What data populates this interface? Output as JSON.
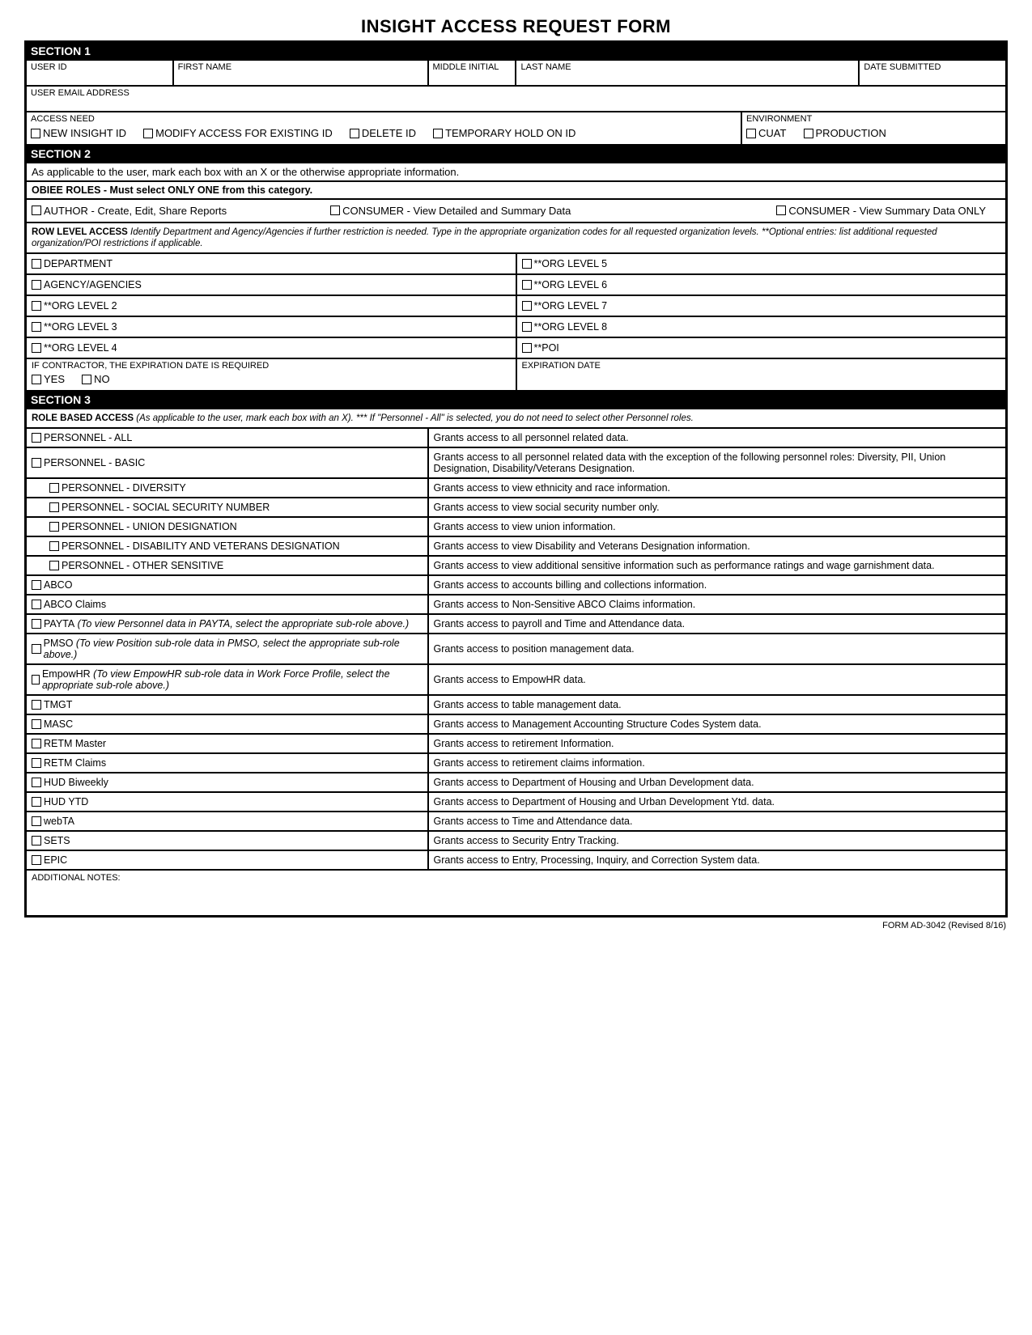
{
  "title": "INSIGHT ACCESS REQUEST FORM",
  "footer": "FORM AD-3042 (Revised 8/16)",
  "s1": {
    "header": "SECTION 1",
    "user_id": "USER ID",
    "first_name": "FIRST NAME",
    "mi": "MIDDLE INITIAL",
    "last_name": "LAST NAME",
    "date_sub": "DATE SUBMITTED",
    "email": "USER EMAIL ADDRESS",
    "access_need": "ACCESS NEED",
    "opt_new": "NEW INSIGHT ID",
    "opt_modify": "MODIFY ACCESS FOR EXISTING ID",
    "opt_delete": "DELETE ID",
    "opt_hold": "TEMPORARY HOLD ON ID",
    "env": "ENVIRONMENT",
    "env_cuat": "CUAT",
    "env_prod": "PRODUCTION"
  },
  "s2": {
    "header": "SECTION 2",
    "instr": "As applicable to the user, mark each box with an X or the otherwise appropriate information.",
    "obiee_hdr": "OBIEE ROLES - Must select ONLY ONE from this category.",
    "obiee_author": "AUTHOR - Create, Edit, Share Reports",
    "obiee_cons1": "CONSUMER - View Detailed and Summary Data",
    "obiee_cons2": "CONSUMER - View Summary Data ONLY",
    "rla_hdr": "ROW LEVEL ACCESS",
    "rla_txt": " Identify Department and Agency/Agencies if further restriction is needed. Type in the appropriate organization codes for all requested organization levels. **Optional entries: list additional requested organization/POI restrictions if applicable.",
    "dept": "DEPARTMENT",
    "agency": "AGENCY/AGENCIES",
    "ol2": "**ORG LEVEL 2",
    "ol3": "**ORG LEVEL 3",
    "ol4": "**ORG LEVEL 4",
    "ol5": "**ORG LEVEL 5",
    "ol6": "**ORG LEVEL 6",
    "ol7": "**ORG LEVEL 7",
    "ol8": "**ORG LEVEL 8",
    "poi": "**POI",
    "contractor": "IF CONTRACTOR, THE EXPIRATION DATE IS REQUIRED",
    "yes": "YES",
    "no": "NO",
    "expdate": "EXPIRATION DATE"
  },
  "s3": {
    "header": "SECTION 3",
    "rba_hdr": "ROLE BASED ACCESS",
    "rba_txt": " (As applicable to the user, mark each box with an X). *** If \"Personnel - All\" is selected, you do not need to select other Personnel roles.",
    "roles": [
      {
        "l": "PERSONNEL - ALL",
        "d": "Grants access to all personnel related data.",
        "indent": false
      },
      {
        "l": "PERSONNEL - BASIC",
        "d": "Grants access to all personnel related data with the exception of the following personnel roles: Diversity, PII, Union Designation, Disability/Veterans Designation.",
        "indent": false
      },
      {
        "l": "PERSONNEL - DIVERSITY",
        "d": "Grants access to view ethnicity and race information.",
        "indent": true
      },
      {
        "l": "PERSONNEL - SOCIAL SECURITY NUMBER",
        "d": "Grants access to view social security number only.",
        "indent": true
      },
      {
        "l": "PERSONNEL - UNION DESIGNATION",
        "d": "Grants access to view union information.",
        "indent": true
      },
      {
        "l": "PERSONNEL - DISABILITY AND VETERANS DESIGNATION",
        "d": "Grants access to view Disability and Veterans Designation information.",
        "indent": true
      },
      {
        "l": "PERSONNEL - OTHER SENSITIVE",
        "d": "Grants access to view additional sensitive information such as performance ratings and wage garnishment data.",
        "indent": true
      },
      {
        "l": "ABCO",
        "d": "Grants access to accounts billing and collections information.",
        "indent": false
      },
      {
        "l": "ABCO Claims",
        "d": "Grants access to Non-Sensitive ABCO Claims information.",
        "indent": false
      },
      {
        "l": "PAYTA",
        "note": " (To view Personnel data in PAYTA, select the appropriate sub-role above.)",
        "d": "Grants access to payroll and Time and Attendance data.",
        "indent": false
      },
      {
        "l": "PMSO",
        "note": " (To view Position sub-role data in PMSO, select the appropriate sub-role above.)",
        "d": "Grants access to position management data.",
        "indent": false
      },
      {
        "l": "EmpowHR",
        "note": " (To view EmpowHR sub-role data in Work Force Profile, select the appropriate sub-role above.)",
        "d": "Grants access to EmpowHR data.",
        "indent": false
      },
      {
        "l": "TMGT",
        "d": "Grants access to table management data.",
        "indent": false
      },
      {
        "l": "MASC",
        "d": "Grants access to Management Accounting Structure Codes System data.",
        "indent": false
      },
      {
        "l": "RETM Master",
        "d": "Grants access to retirement Information.",
        "indent": false
      },
      {
        "l": "RETM Claims",
        "d": "Grants access to retirement claims information.",
        "indent": false
      },
      {
        "l": "HUD Biweekly",
        "d": "Grants access to Department of Housing and Urban Development data.",
        "indent": false
      },
      {
        "l": "HUD YTD",
        "d": "Grants access to Department of Housing and Urban Development Ytd. data.",
        "indent": false
      },
      {
        "l": "webTA",
        "d": "Grants access to Time and Attendance data.",
        "indent": false
      },
      {
        "l": "SETS",
        "d": "Grants access to Security Entry Tracking.",
        "indent": false
      },
      {
        "l": "EPIC",
        "d": "Grants access to Entry, Processing, Inquiry, and Correction System data.",
        "indent": false
      }
    ],
    "notes": "ADDITIONAL NOTES:"
  }
}
